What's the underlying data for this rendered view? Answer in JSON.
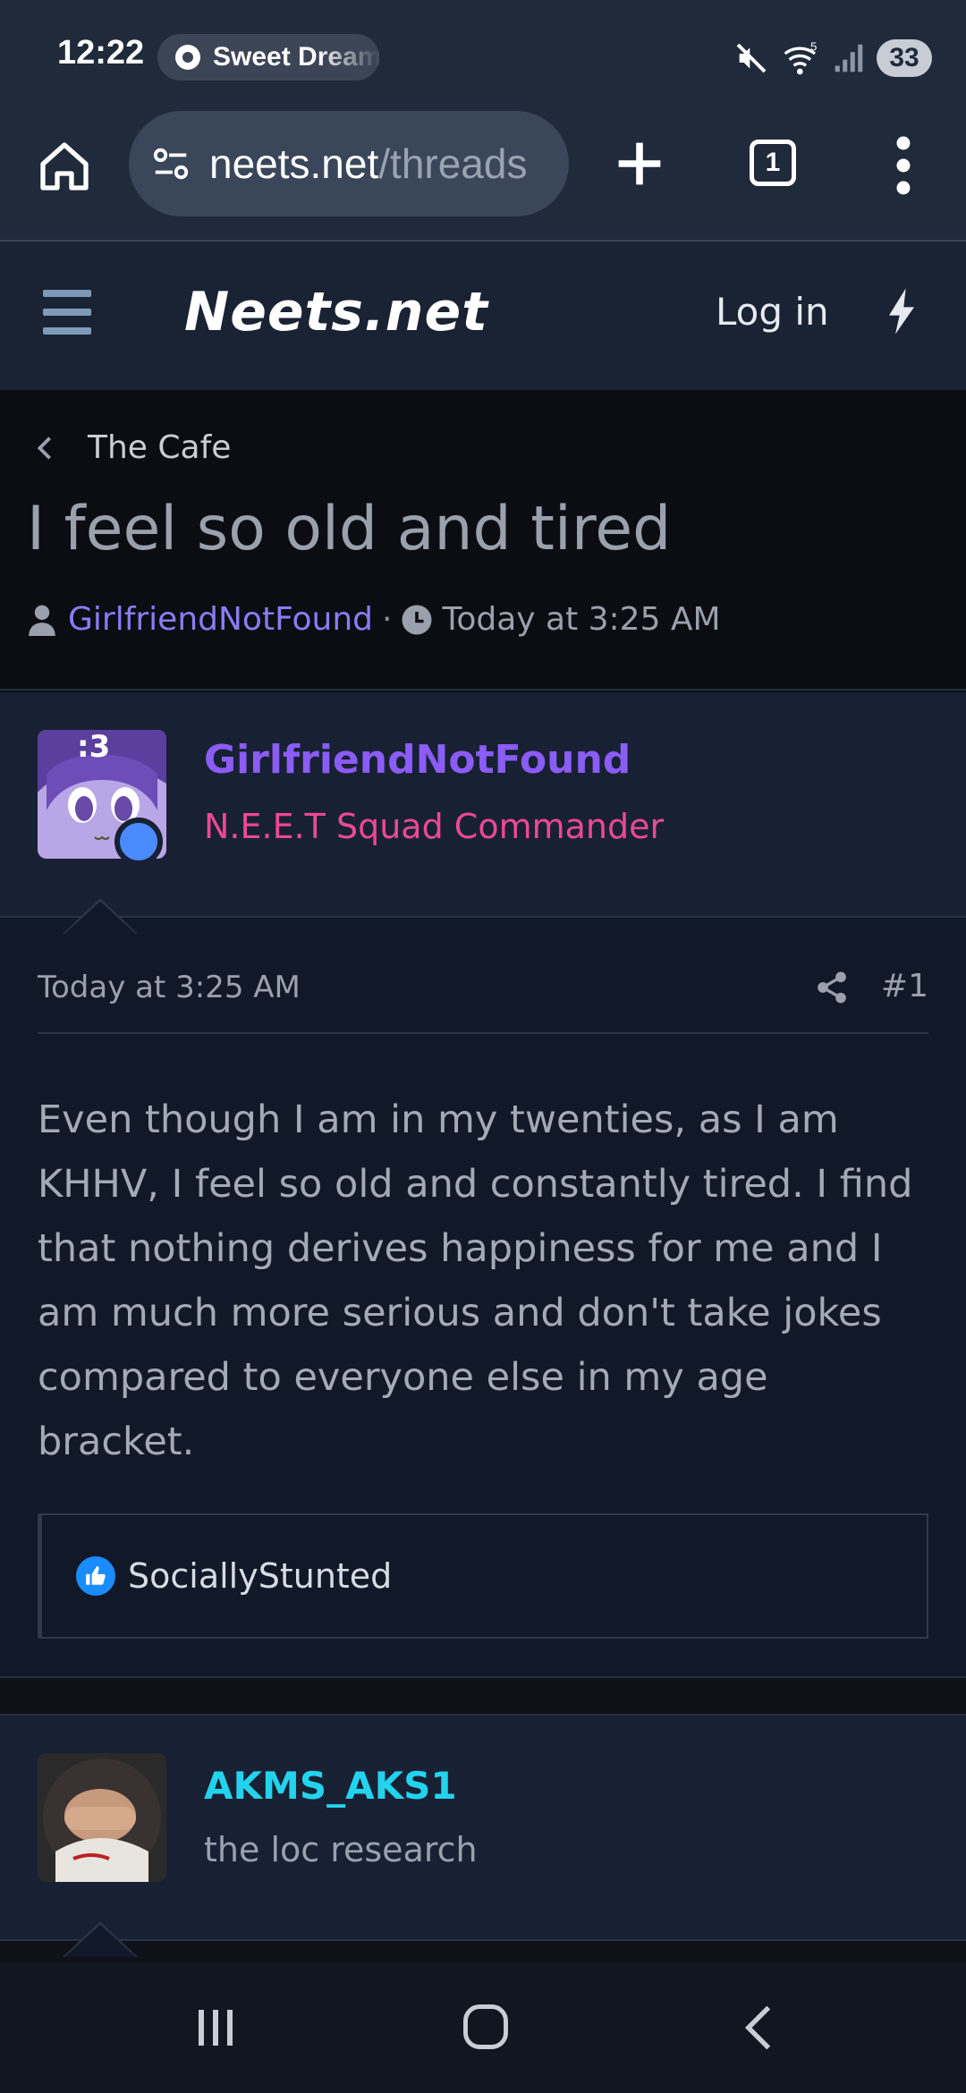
{
  "status_bar": {
    "time": "12:22",
    "media_title": "Sweet Dreams",
    "battery": "33",
    "wifi_badge": "5"
  },
  "browser": {
    "url_host": "neets.net",
    "url_path": "/threads",
    "tab_count": "1"
  },
  "site": {
    "logo": "Neets.net",
    "login_label": "Log in"
  },
  "thread": {
    "breadcrumb": "The Cafe",
    "title": "I feel so old and tired",
    "author": "GirlfriendNotFound",
    "separator": "·",
    "time": "Today at 3:25 AM"
  },
  "posts": [
    {
      "avatar_text": ":3",
      "username": "GirlfriendNotFound",
      "user_title": "N.E.E.T Squad Commander",
      "date": "Today at 3:25 AM",
      "number": "#1",
      "body": "Even though I am in my twenties, as I am KHHV, I feel so old and constantly tired. I find that nothing derives happiness for me and I am much more serious and don't take jokes compared to everyone else in my age bracket.",
      "reactions": "SociallyStunted"
    },
    {
      "username": "AKMS_AKS1",
      "user_title": "the loc research"
    }
  ],
  "colors": {
    "accent_purple": "#8b5cf6",
    "accent_pink": "#ec4899",
    "accent_cyan": "#22d3ee",
    "online": "#4a8cff"
  },
  "icons": {
    "home": "home-icon",
    "site_settings": "site-settings-icon",
    "new_tab": "plus-icon",
    "tabs": "tab-switcher-icon",
    "browser_menu": "more-vertical-icon",
    "hamburger": "hamburger-icon",
    "bolt": "lightning-icon",
    "share": "share-icon",
    "like": "thumbs-up-icon"
  }
}
